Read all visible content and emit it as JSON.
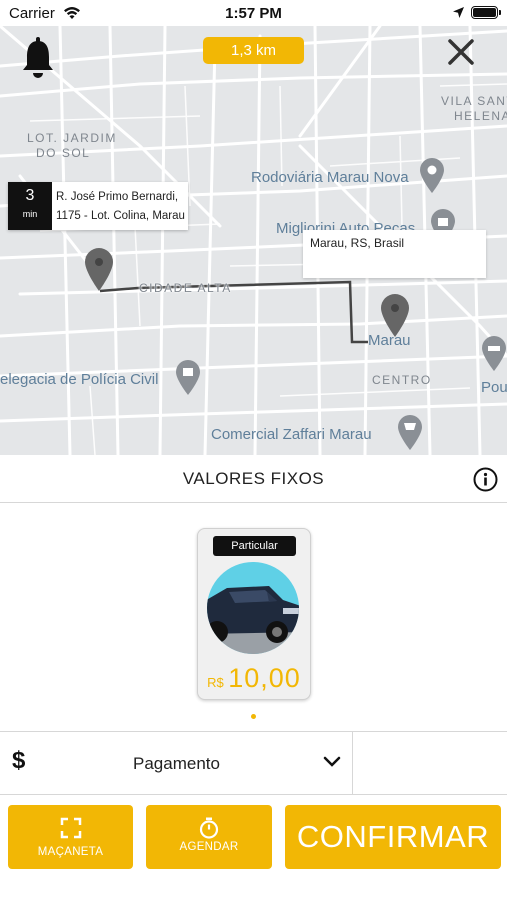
{
  "status_bar": {
    "carrier": "Carrier",
    "time": "1:57 PM"
  },
  "map": {
    "distance": "1,3 km",
    "eta": {
      "value": "3",
      "unit": "min",
      "address_line1": "R. José Primo Bernardi,",
      "address_line2": "1175 - Lot. Colina, Marau -"
    },
    "destination": "Marau, RS, Brasil",
    "labels": {
      "lot_jardim": "LOT. JARDIM",
      "do_sol": "DO SOL",
      "vila_santa": "VILA SANTA",
      "helena": "HELENA",
      "rodoviaria": "Rodoviária Marau Nova",
      "migliorini": "Migliorini Auto Peças",
      "cidade_alta": "CIDADE ALTA",
      "marau": "Marau",
      "delegacia": "elegacia de Polícia Civil",
      "centro": "CENTRO",
      "pou": "Pou",
      "zaffari": "Comercial Zaffari Marau"
    }
  },
  "section": {
    "title": "VALORES FIXOS"
  },
  "card": {
    "tag": "Particular",
    "currency": "R$",
    "price": "10,00"
  },
  "payment": {
    "label": "Pagamento"
  },
  "actions": {
    "macaneta": "MAÇANETA",
    "agendar": "AGENDAR",
    "confirmar": "CONFIRMAR"
  },
  "colors": {
    "accent": "#f2b705",
    "map_background": "#e4e6e8",
    "route": "#444444",
    "pin": "#666666"
  },
  "icons": [
    "bell-icon",
    "close-icon",
    "info-icon",
    "dollar-icon",
    "chevron-down-icon",
    "expand-icon",
    "stopwatch-icon",
    "map-pin-icon",
    "wifi-icon",
    "location-arrow-icon",
    "battery-icon",
    "car-icon"
  ]
}
